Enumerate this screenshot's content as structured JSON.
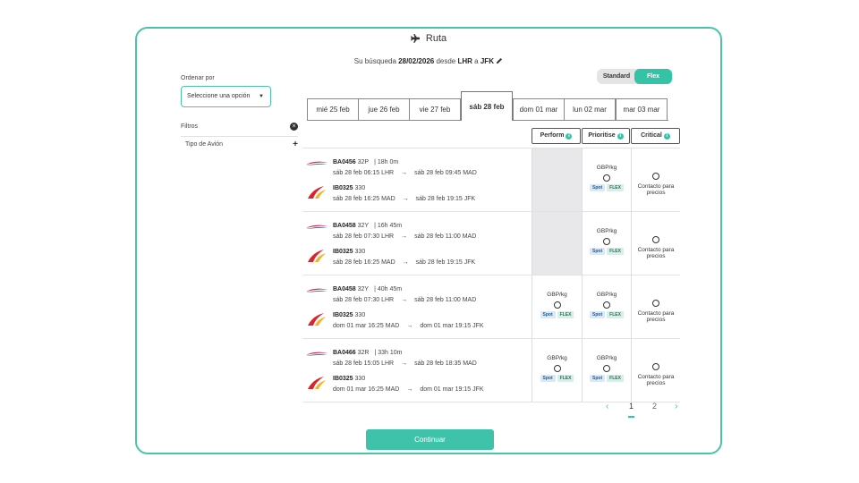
{
  "header": {
    "title": "Ruta"
  },
  "search": {
    "prefix": "Su búsqueda",
    "date": "28/02/2026",
    "from_word": "desde",
    "origin": "LHR",
    "to_word": "a",
    "destination": "JFK"
  },
  "fare_toggle": {
    "standard": "Standard",
    "flex": "Flex",
    "selected": "Flex"
  },
  "sort": {
    "label": "Ordenar por",
    "placeholder": "Seleccione una opción"
  },
  "filters": {
    "title": "Filtros",
    "aircraft_type": "Tipo de Avión"
  },
  "date_tabs": [
    "mié 25 feb",
    "jue 26 feb",
    "vie 27 feb",
    "sáb 28 feb",
    "dom 01 mar",
    "lun 02 mar",
    "mar 03 mar"
  ],
  "active_date_index": 3,
  "columns": [
    "Perform",
    "Prioritise",
    "Critical"
  ],
  "rows": [
    {
      "leg1": {
        "flight": "BA0456",
        "fare": "32P",
        "duration": "| 18h 0m",
        "dep": "sáb 28 feb 06:15 LHR",
        "arr": "sáb 28 feb 09:45 MAD"
      },
      "leg2": {
        "flight": "IB0325",
        "fare": "330",
        "dep": "sáb 28 feb 16:25 MAD",
        "arr": "sáb 28 feb 19:15 JFK"
      },
      "perform": null,
      "prioritise": "GBP/kg",
      "critical": "Contacto para precios"
    },
    {
      "leg1": {
        "flight": "BA0458",
        "fare": "32Y",
        "duration": "| 16h 45m",
        "dep": "sáb 28 feb 07:30 LHR",
        "arr": "sáb 28 feb 11:00 MAD"
      },
      "leg2": {
        "flight": "IB0325",
        "fare": "330",
        "dep": "sáb 28 feb 16:25 MAD",
        "arr": "sáb 28 feb 19:15 JFK"
      },
      "perform": null,
      "prioritise": "GBP/kg",
      "critical": "Contacto para precios"
    },
    {
      "leg1": {
        "flight": "BA0458",
        "fare": "32Y",
        "duration": "| 40h 45m",
        "dep": "sáb 28 feb 07:30 LHR",
        "arr": "sáb 28 feb 11:00 MAD"
      },
      "leg2": {
        "flight": "IB0325",
        "fare": "330",
        "dep": "dom 01 mar 16:25 MAD",
        "arr": "dom 01 mar 19:15 JFK"
      },
      "perform": "GBP/kg",
      "prioritise": "GBP/kg",
      "critical": "Contacto para precios"
    },
    {
      "leg1": {
        "flight": "BA0466",
        "fare": "32R",
        "duration": "| 33h 10m",
        "dep": "sáb 28 feb 15:05 LHR",
        "arr": "sáb 28 feb 18:35 MAD"
      },
      "leg2": {
        "flight": "IB0325",
        "fare": "330",
        "dep": "dom 01 mar 16:25 MAD",
        "arr": "dom 01 mar 19:15 JFK"
      },
      "perform": "GBP/kg",
      "prioritise": "GBP/kg",
      "critical": "Contacto para precios"
    }
  ],
  "tags": {
    "spot": "Spot",
    "flex": "FLEX"
  },
  "pagination": {
    "pages": [
      "1",
      "2"
    ],
    "current": "1"
  },
  "cta": {
    "label": "Continuar"
  },
  "colors": {
    "accent": "#35c3a8",
    "border": "#4cc2ab",
    "ba_red": "#d5203b",
    "ba_blue": "#1c3f7f",
    "ib_red": "#d8262e",
    "ib_yellow": "#f4b326"
  },
  "icons": {
    "title": "airplane-icon",
    "edit": "pencil-icon",
    "clear_filters": "close-circle-icon",
    "expand": "plus-icon",
    "sort_caret": "caret-down-icon",
    "info": "info-icon",
    "prev": "chevron-left-icon",
    "next": "chevron-right-icon"
  }
}
